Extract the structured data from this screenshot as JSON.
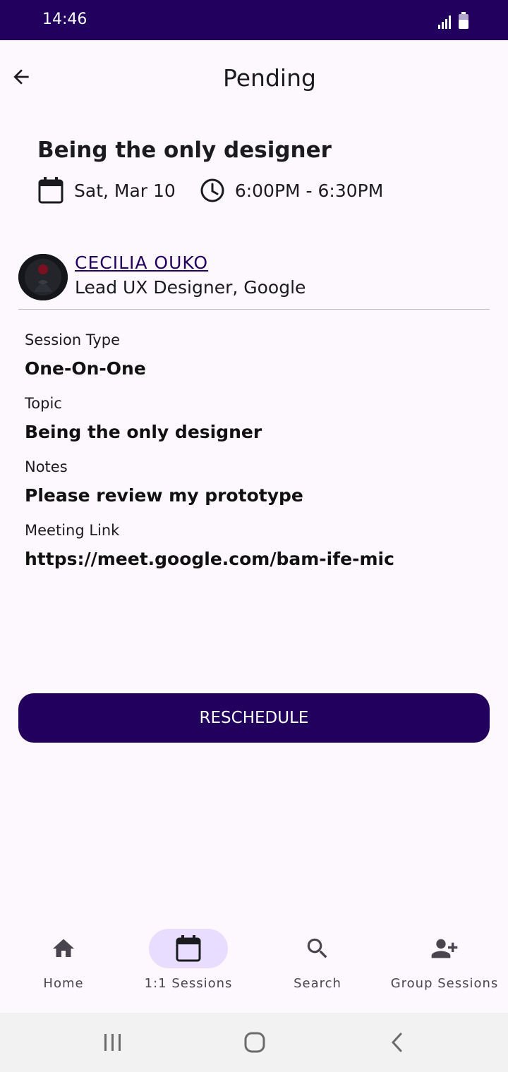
{
  "status_bar": {
    "time": "14:46",
    "signal_icon": "signal-icon",
    "battery_icon": "battery-icon"
  },
  "app_bar": {
    "title": "Pending",
    "back_icon": "arrow-back-icon"
  },
  "session": {
    "title": "Being the only designer",
    "date": "Sat, Mar 10",
    "time": "6:00PM - 6:30PM"
  },
  "mentor": {
    "name": "CECILIA OUKO",
    "role": "Lead UX Designer, Google"
  },
  "details": [
    {
      "label": "Session Type",
      "value": "One-On-One"
    },
    {
      "label": "Topic",
      "value": "Being the only designer"
    },
    {
      "label": "Notes",
      "value": "Please review my prototype"
    },
    {
      "label": "Meeting Link",
      "value": "https://meet.google.com/bam-ife-mic"
    }
  ],
  "actions": {
    "reschedule_label": "RESCHEDULE"
  },
  "bottom_nav": {
    "items": [
      {
        "label": "Home",
        "icon": "home-icon",
        "active": false
      },
      {
        "label": "1:1 Sessions",
        "icon": "calendar-icon",
        "active": true
      },
      {
        "label": "Search",
        "icon": "search-icon",
        "active": false
      },
      {
        "label": "Group Sessions",
        "icon": "person-add-icon",
        "active": false
      }
    ]
  },
  "colors": {
    "primary": "#22005d",
    "background": "#fdf8fd",
    "active_indicator": "#e9ddff",
    "divider": "#b8b6bc"
  }
}
